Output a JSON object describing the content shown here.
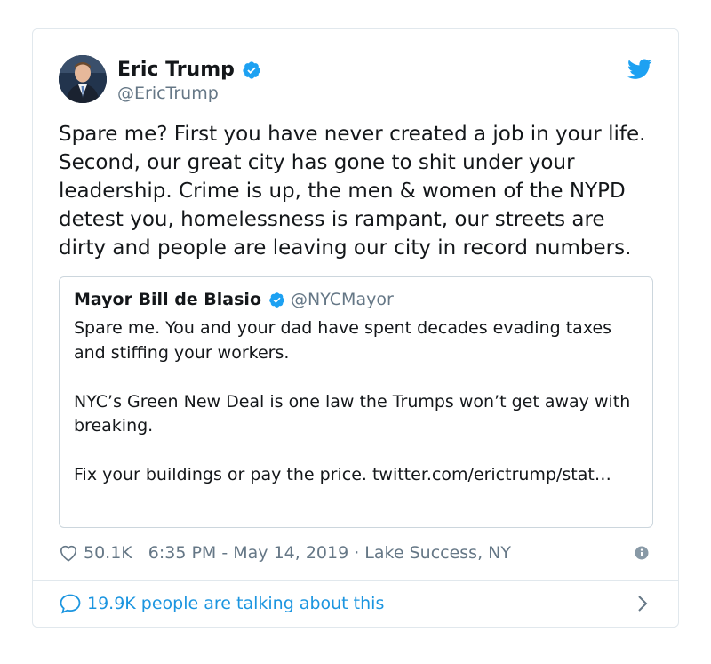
{
  "tweet": {
    "author": {
      "display_name": "Eric Trump",
      "handle": "@EricTrump",
      "verified": true
    },
    "text": "Spare me? First you have never created a job in your life. Second, our great city has gone to shit under your leadership. Crime is up, the men & women of the NYPD detest you, homelessness is rampant, our streets are dirty and people are leaving our city in record numbers.",
    "quoted": {
      "display_name": "Mayor Bill de Blasio",
      "handle": "@NYCMayor",
      "verified": true,
      "paragraphs": [
        "Spare me. You and your dad have spent decades evading taxes and stiffing your workers.",
        "NYC’s Green New Deal is one law the Trumps won’t get away with breaking.",
        "Fix your buildings or pay the price. twitter.com/erictrump/stat…"
      ]
    },
    "meta": {
      "likes": "50.1K",
      "timestamp": "6:35 PM - May 14, 2019 · Lake Success, NY"
    },
    "conversation": {
      "label": "19.9K people are talking about this"
    }
  },
  "icons": {
    "verified": "verified-badge-icon",
    "twitter": "twitter-bird-icon",
    "like": "heart-outline-icon",
    "info": "info-circle-icon",
    "reply": "speech-bubble-icon",
    "chevron": "chevron-right-icon"
  },
  "colors": {
    "brand_blue": "#1da1f2",
    "link_blue": "#1b95e0",
    "secondary_text": "#657786",
    "border": "#e1e8ed"
  }
}
